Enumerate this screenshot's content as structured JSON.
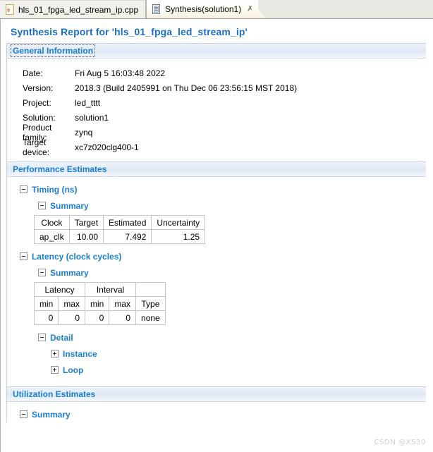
{
  "tabs": [
    {
      "label": "hls_01_fpga_led_stream_ip.cpp",
      "icon": "cpp-file-icon",
      "active": false,
      "closable": false
    },
    {
      "label": "Synthesis(solution1)",
      "icon": "report-document-icon",
      "active": true,
      "closable": true,
      "close_glyph": "✗"
    }
  ],
  "page_title": "Synthesis Report for 'hls_01_fpga_led_stream_ip'",
  "colors": {
    "heading_blue": "#1a6fc4",
    "link_blue": "#1a7fd4",
    "banner_top": "#eef3fa",
    "banner_bottom": "#f4f7fb",
    "table_border": "#c6c6c6",
    "tabbar_bg": "#e9e8e3"
  },
  "sections": [
    {
      "id": "general-information",
      "title": "General Information",
      "focused": true,
      "fields": [
        {
          "label": "Date:",
          "value": "Fri Aug 5 16:03:48 2022"
        },
        {
          "label": "Version:",
          "value": "2018.3 (Build 2405991 on Thu Dec 06 23:56:15 MST 2018)"
        },
        {
          "label": "Project:",
          "value": "led_tttt"
        },
        {
          "label": "Solution:",
          "value": "solution1"
        },
        {
          "label": "Product family:",
          "value": "zynq"
        },
        {
          "label": "Target device:",
          "value": "xc7z020clg400-1"
        }
      ]
    },
    {
      "id": "performance-estimates",
      "title": "Performance Estimates",
      "focused": false
    },
    {
      "id": "utilization-estimates",
      "title": "Utilization Estimates",
      "focused": false
    }
  ],
  "tree": {
    "timing": {
      "label": "Timing (ns)",
      "state": "expanded",
      "toggle": "minus"
    },
    "timing_summary": {
      "label": "Summary",
      "state": "expanded",
      "toggle": "minus"
    },
    "latency": {
      "label": "Latency (clock cycles)",
      "state": "expanded",
      "toggle": "minus"
    },
    "latency_summary": {
      "label": "Summary",
      "state": "expanded",
      "toggle": "minus"
    },
    "detail": {
      "label": "Detail",
      "state": "expanded",
      "toggle": "minus"
    },
    "instance": {
      "label": "Instance",
      "state": "collapsed",
      "toggle": "plus"
    },
    "loop": {
      "label": "Loop",
      "state": "collapsed",
      "toggle": "plus"
    },
    "utilization_summary": {
      "label": "Summary",
      "state": "expanded",
      "toggle": "minus"
    }
  },
  "timing_table": {
    "headers": [
      "Clock",
      "Target",
      "Estimated",
      "Uncertainty"
    ],
    "rows": [
      {
        "clock": "ap_clk",
        "target": "10.00",
        "estimated": "7.492",
        "uncertainty": "1.25"
      }
    ]
  },
  "latency_table": {
    "group_headers": [
      "Latency",
      "Interval",
      ""
    ],
    "sub_headers": [
      "min",
      "max",
      "min",
      "max",
      "Type"
    ],
    "rows": [
      {
        "latency_min": "0",
        "latency_max": "0",
        "interval_min": "0",
        "interval_max": "0",
        "type": "none"
      }
    ]
  },
  "watermark": "CSDN @XS30"
}
